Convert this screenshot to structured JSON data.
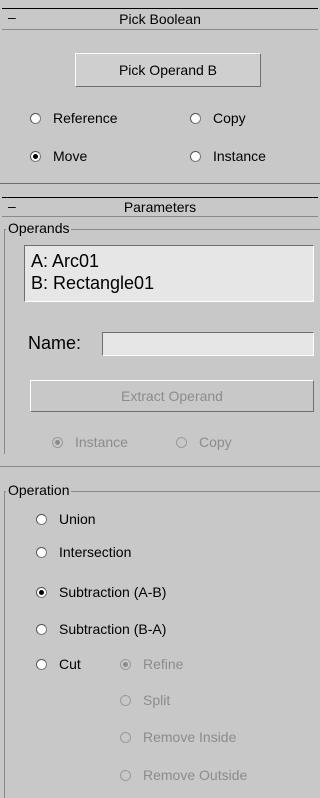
{
  "pick_boolean": {
    "title": "Pick Boolean",
    "collapse": "–",
    "pick_button": "Pick Operand B",
    "options": {
      "reference": "Reference",
      "copy": "Copy",
      "move": "Move",
      "instance": "Instance"
    },
    "selected": "Move"
  },
  "parameters": {
    "title": "Parameters",
    "collapse": "–",
    "operands": {
      "group_label": "Operands",
      "items": [
        "A: Arc01",
        "B: Rectangle01"
      ],
      "name_label": "Name:",
      "name_value": "",
      "extract_button": "Extract Operand",
      "extract_options": {
        "instance": "Instance",
        "copy": "Copy"
      },
      "extract_selected": "Instance"
    },
    "operation": {
      "group_label": "Operation",
      "options": {
        "union": "Union",
        "intersection": "Intersection",
        "subtraction_ab": "Subtraction (A-B)",
        "subtraction_ba": "Subtraction (B-A)",
        "cut": "Cut"
      },
      "selected": "Subtraction (A-B)",
      "cut_options": {
        "refine": "Refine",
        "split": "Split",
        "remove_inside": "Remove Inside",
        "remove_outside": "Remove Outside"
      },
      "cut_selected": "Refine"
    }
  }
}
